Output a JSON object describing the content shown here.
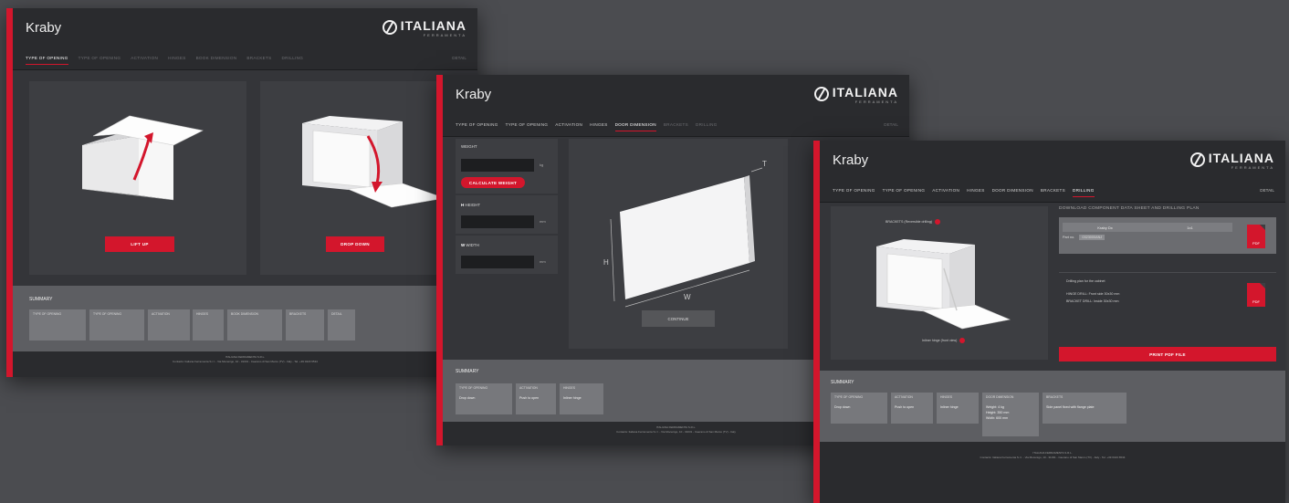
{
  "window1": {
    "title": "Kraby",
    "logo": "ITALIANA",
    "logo_sub": "FERRAMENTA",
    "tabs": [
      "TYPE OF OPENING",
      "TYPE OF OPENING",
      "ACTIVATION",
      "HINGES",
      "BOOK DIMENSION",
      "BRACKETS",
      "DRILLING"
    ],
    "nav_right": "DETAIL",
    "option_left": "LIFT UP",
    "option_right": "DROP DOWN",
    "summary_title": "SUMMARY",
    "summary_items": [
      "TYPE OF OPENING",
      "TYPE OF OPENING",
      "ACTIVATION",
      "HINGES",
      "BOOK DIMENSION",
      "BRACKETS",
      "DETAIL"
    ],
    "footer_line1": "ITALIANA FERRAMENTA S.R.L.",
    "footer_line2": "Contacts: Italiana Ferramenta S.r.l. - Via Mocenigo, 10 - 31031 - Caerano di San Marco (TV) - Italy - Tel. +39 0423 6534"
  },
  "window2": {
    "title": "Kraby",
    "logo": "ITALIANA",
    "logo_sub": "FERRAMENTA",
    "tabs": [
      "TYPE OF OPENING",
      "TYPE OF OPENING",
      "ACTIVATION",
      "HINGES",
      "DOOR DIMENSION",
      "BRACKETS",
      "DRILLING"
    ],
    "nav_right": "DETAIL",
    "weight_label": "WEIGHT",
    "weight_unit": "kg",
    "calc_button": "CALCULATE WEIGHT",
    "height_label": "HEIGHT",
    "height_unit": "mm",
    "width_label": "WIDTH",
    "width_unit": "mm",
    "dim_h": "H",
    "dim_w": "W",
    "dim_t": "T",
    "continue_button": "CONTINUE",
    "summary_title": "SUMMARY",
    "summary_items": [
      {
        "label": "TYPE OF OPENING",
        "value": "Drop down"
      },
      {
        "label": "ACTIVATION",
        "value": "Push to open"
      },
      {
        "label": "HINGES",
        "value": "Inliner hinge"
      }
    ],
    "footer_line1": "ITALIANA FERRAMENTA S.R.L.",
    "footer_line2": "Contacts: Italiana Ferramenta S.r.l. - Via Mocenigo, 10 - 31031 - Caerano di San Marco (TV) - Italy"
  },
  "window3": {
    "title": "Kraby",
    "logo": "ITALIANA",
    "logo_sub": "FERRAMENTA",
    "tabs": [
      "TYPE OF OPENING",
      "TYPE OF OPENING",
      "ACTIVATION",
      "HINGES",
      "DOOR DIMENSION",
      "BRACKETS",
      "DRILLING"
    ],
    "nav_right": "DETAIL",
    "bracket_label": "BRACKETS (Reversible drilling)",
    "hinge_label": "Inliner hinge (front view)",
    "download_title": "DOWNLOAD COMPONENT DATA SHEET AND DRILLING PLAN",
    "part_name": "Kraby Dx",
    "part_qty": "1x1",
    "part_code_label": "Part no.",
    "part_code": "0323000ANJ",
    "pdf_label": "PDF",
    "drilling_title": "Drilling plan for the cabinet",
    "drilling_line1": "HINGE DRILL: Front side 30x30 mm",
    "drilling_line2": "BRACKET DRILL: Inside 30x30 mm",
    "print_button": "PRINT PDF FILE",
    "summary_title": "SUMMARY",
    "summary_items": [
      {
        "label": "TYPE OF OPENING",
        "value": "Drop down"
      },
      {
        "label": "ACTIVATION",
        "value": "Push to open"
      },
      {
        "label": "HINGES",
        "value": "Inliner hinge"
      },
      {
        "label": "DOOR DIMENSION",
        "value": "Weight: 4 kg\nHeight: 350 mm\nWidth: 600 mm"
      },
      {
        "label": "BRACKETS",
        "value": "Side panel fixed with flange plate"
      }
    ],
    "footer_line1": "ITALIANA FERRAMENTA S.R.L.",
    "footer_line2": "Contacts: Italiana Ferramenta S.r.l. - Via Mocenigo, 10 - 31031 - Caerano di San Marco (TV) - Italy - Tel. +39 0423 6534"
  },
  "colors": {
    "accent": "#d3162c",
    "background": "#4b4c50",
    "window": "#2a2b2e"
  }
}
